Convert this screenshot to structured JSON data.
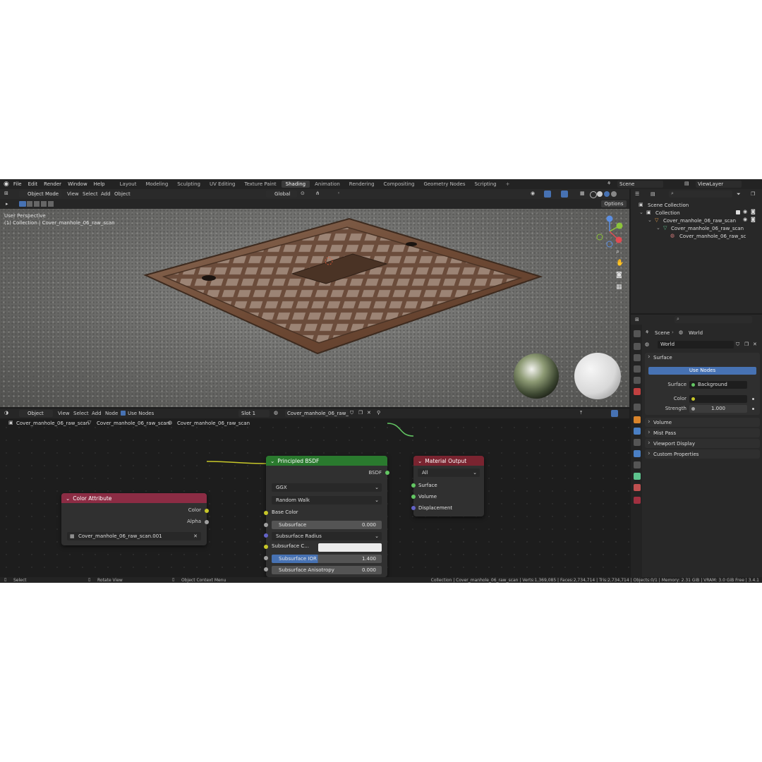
{
  "menu": [
    "File",
    "Edit",
    "Render",
    "Window",
    "Help"
  ],
  "workspaces": [
    "Layout",
    "Modeling",
    "Sculpting",
    "UV Editing",
    "Texture Paint",
    "Shading",
    "Animation",
    "Rendering",
    "Compositing",
    "Geometry Nodes",
    "Scripting"
  ],
  "active_workspace": "Shading",
  "scene_name": "Scene",
  "view_layer": "ViewLayer",
  "viewport": {
    "mode": "Object Mode",
    "menus": [
      "View",
      "Select",
      "Add",
      "Object"
    ],
    "orientation": "Global",
    "options_label": "Options",
    "perspective": "User Perspective",
    "collection_info": "(1) Collection | Cover_manhole_06_raw_scan"
  },
  "node_editor": {
    "type": "Object",
    "menus": [
      "View",
      "Select",
      "Add",
      "Node"
    ],
    "use_nodes_label": "Use Nodes",
    "slot": "Slot 1",
    "material": "Cover_manhole_06_raw_scan",
    "breadcrumb": [
      "Cover_manhole_06_raw_scan",
      "Cover_manhole_06_raw_scan",
      "Cover_manhole_06_raw_scan"
    ],
    "color_attribute": {
      "title": "Color Attribute",
      "out_color": "Color",
      "out_alpha": "Alpha",
      "layer": "Cover_manhole_06_raw_scan.001"
    },
    "principled": {
      "title": "Principled BSDF",
      "out": "BSDF",
      "distribution": "GGX",
      "subsurface_method": "Random Walk",
      "base_color": "Base Color",
      "subsurface": "Subsurface",
      "subsurface_value": "0.000",
      "subsurface_radius": "Subsurface Radius",
      "subsurface_color": "Subsurface C...",
      "subsurface_ior": "Subsurface IOR",
      "subsurface_ior_value": "1.400",
      "subsurface_aniso": "Subsurface Anisotropy",
      "subsurface_aniso_value": "0.000"
    },
    "material_output": {
      "title": "Material Output",
      "target": "All",
      "surface": "Surface",
      "volume": "Volume",
      "displacement": "Displacement"
    }
  },
  "outliner": {
    "root": "Scene Collection",
    "collection": "Collection",
    "object": "Cover_manhole_06_raw_scan",
    "mesh": "Cover_manhole_06_raw_scan",
    "material": "Cover_manhole_06_raw_sc"
  },
  "properties": {
    "breadcrumb_scene": "Scene",
    "breadcrumb_world": "World",
    "world_name": "World",
    "surface_panel": "Surface",
    "use_nodes": "Use Nodes",
    "surface_label": "Surface",
    "surface_value": "Background",
    "color_label": "Color",
    "strength_label": "Strength",
    "strength_value": "1.000",
    "panels": [
      "Volume",
      "Mist Pass",
      "Viewport Display",
      "Custom Properties"
    ]
  },
  "statusbar": {
    "select": "Select",
    "rotate": "Rotate View",
    "context": "Object Context Menu",
    "stats": "Collection | Cover_manhole_06_raw_scan | Verts:1,369,085 | Faces:2,734,714 | Tris:2,734,714 | Objects:0/1 | Memory: 2.31 GiB | VRAM: 3.0 GiB Free | 3.4.1"
  },
  "colors": {
    "active_blue": "#4772b3",
    "bsdf_header": "#2a7a2e",
    "output_header": "#7a2430",
    "attr_header": "#8c2c44",
    "socket_yellow": "#c7c729",
    "socket_grey": "#a1a1a1",
    "socket_violet": "#6363c7",
    "socket_green": "#63c763"
  }
}
